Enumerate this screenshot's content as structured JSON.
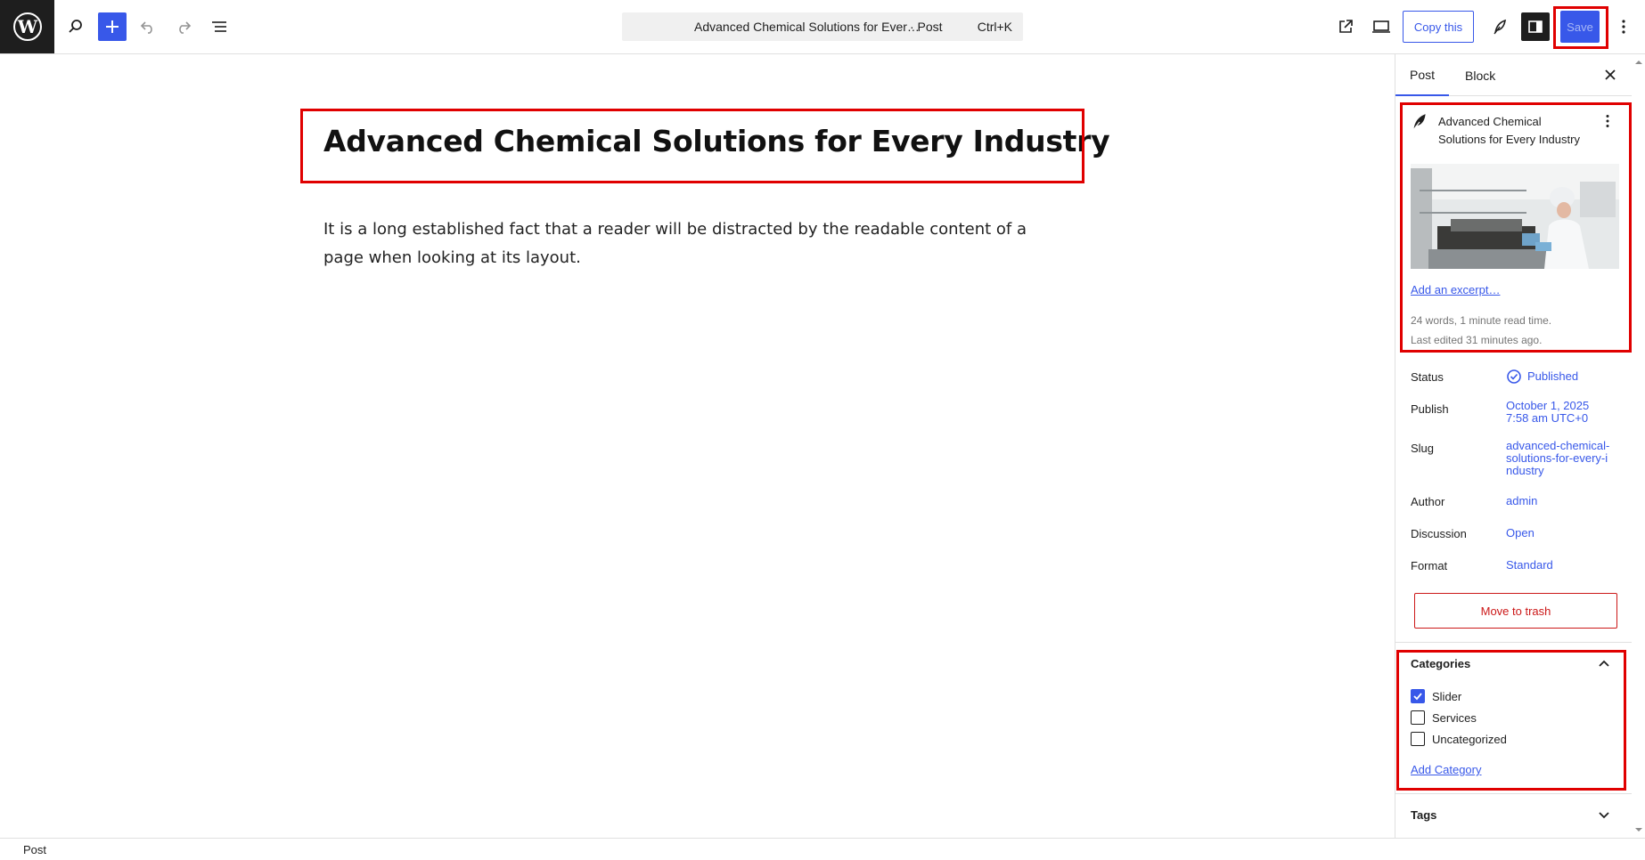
{
  "toolbar": {
    "document_title": "Advanced Chemical Solutions for Ever…",
    "document_type": "· Post",
    "shortcut": "Ctrl+K",
    "copy_label": "Copy this",
    "save_label": "Save"
  },
  "editor": {
    "title": "Advanced Chemical Solutions for Every Industry",
    "paragraph": "It is a long established fact that a reader will be distracted by the readable content of a page when looking at its layout."
  },
  "sidebar": {
    "tabs": [
      {
        "label": "Post",
        "active": true
      },
      {
        "label": "Block",
        "active": false
      }
    ],
    "card": {
      "title": "Advanced Chemical Solutions for Every Industry",
      "excerpt_link": "Add an excerpt…",
      "word_count": "24 words, 1 minute read time.",
      "last_edited": "Last edited 31 minutes ago."
    },
    "properties": {
      "status_label": "Status",
      "status_value": "Published",
      "publish_label": "Publish",
      "publish_value": "October 1, 2025 7:58 am UTC+0",
      "slug_label": "Slug",
      "slug_value": "advanced-chemical-solutions-for-every-industry",
      "author_label": "Author",
      "author_value": "admin",
      "discussion_label": "Discussion",
      "discussion_value": "Open",
      "format_label": "Format",
      "format_value": "Standard"
    },
    "trash_label": "Move to trash",
    "categories": {
      "title": "Categories",
      "items": [
        {
          "label": "Slider",
          "checked": true
        },
        {
          "label": "Services",
          "checked": false
        },
        {
          "label": "Uncategorized",
          "checked": false
        }
      ],
      "add_label": "Add Category"
    },
    "tags": {
      "title": "Tags"
    }
  },
  "footer": {
    "breadcrumb": "Post"
  },
  "colors": {
    "accent": "#3858e9",
    "danger": "#cc1818",
    "highlight": "#e00000"
  }
}
